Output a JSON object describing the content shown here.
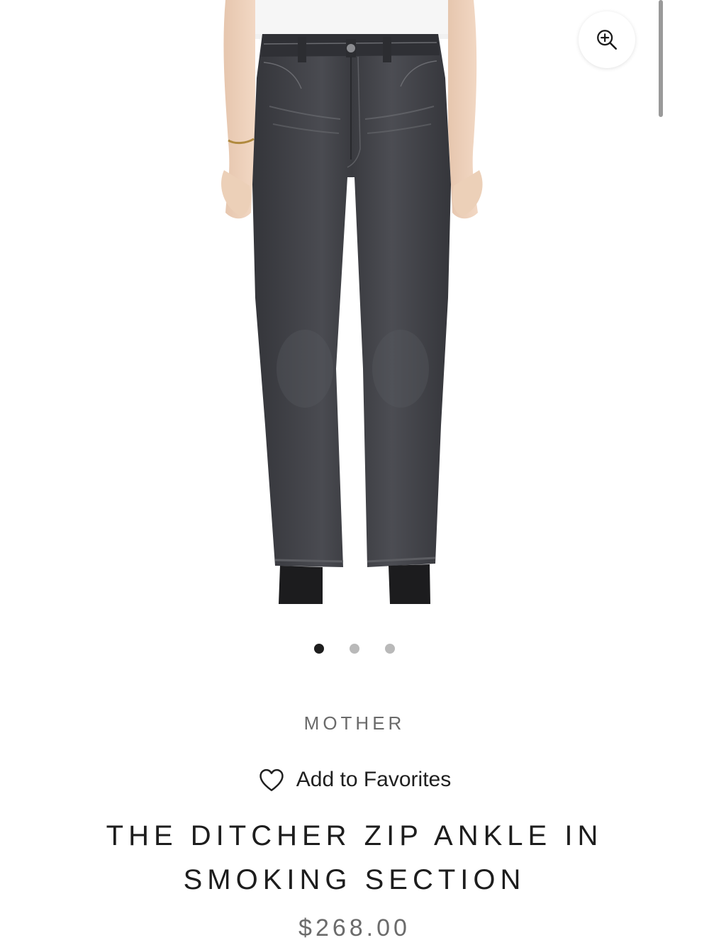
{
  "product": {
    "brand": "MOTHER",
    "favorites_label": "Add to Favorites",
    "title": "THE DITCHER ZIP ANKLE IN SMOKING SECTION",
    "price": "$268.00"
  },
  "gallery": {
    "image_count": 3,
    "active_index": 0,
    "zoom_icon": "zoom-in-icon"
  },
  "colors": {
    "denim": "#3f4045",
    "active_dot": "#1e1e1e",
    "inactive_dot": "#b9b9b9"
  }
}
